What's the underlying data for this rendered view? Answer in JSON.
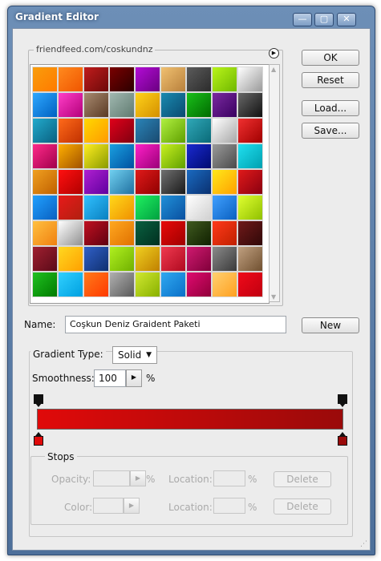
{
  "window": {
    "title": "Gradient Editor",
    "controls": {
      "minimize": "—",
      "maximize": "▢",
      "close": "✕"
    }
  },
  "presets": {
    "label": "friendfeed.com/coskundnz",
    "menu_icon": "triangle-right-icon",
    "swatches": [
      [
        "#f99d0b",
        "#ff7a00"
      ],
      [
        "#ff8a1e",
        "#f05500"
      ],
      [
        "#c01c1c",
        "#6d0a0a"
      ],
      [
        "#7a0000",
        "#2b0000"
      ],
      [
        "#b30cd6",
        "#6a0080"
      ],
      [
        "#f0c070",
        "#b8803c"
      ],
      [
        "#5b5b5b",
        "#2b2b2b"
      ],
      [
        "#b9f41a",
        "#70b800"
      ],
      [
        "#ffffff",
        "#9a9a9a"
      ],
      [
        "#2ea8ff",
        "#0060c0"
      ],
      [
        "#ff3ec8",
        "#b3007a"
      ],
      [
        "#a88a70",
        "#5a3a24"
      ],
      [
        "#a0b8b0",
        "#607a70"
      ],
      [
        "#ffd21a",
        "#d49000"
      ],
      [
        "#1a8ab0",
        "#0a4a70"
      ],
      [
        "#1ac01a",
        "#006a00"
      ],
      [
        "#7a2aa0",
        "#3a0060"
      ],
      [
        "#686868",
        "#111111"
      ],
      [
        "#22aacc",
        "#0a6080"
      ],
      [
        "#ff6a1a",
        "#c03000"
      ],
      [
        "#ffd800",
        "#ff9a00"
      ],
      [
        "#e0001a",
        "#800010"
      ],
      [
        "#2a84b8",
        "#1a4a70"
      ],
      [
        "#b0f040",
        "#60a000"
      ],
      [
        "#30a8b8",
        "#0a6a78"
      ],
      [
        "#ffffff",
        "#a8a8a8"
      ],
      [
        "#f03030",
        "#a00000"
      ],
      [
        "#ff2a8a",
        "#a0004a"
      ],
      [
        "#ffb000",
        "#a05000"
      ],
      [
        "#ffee20",
        "#8a9a00"
      ],
      [
        "#1aa0e0",
        "#0050a0"
      ],
      [
        "#ff20c8",
        "#9a0078"
      ],
      [
        "#c8f020",
        "#60a000"
      ],
      [
        "#1a2ad0",
        "#000a70"
      ],
      [
        "#9a9a9a",
        "#4a4a4a"
      ],
      [
        "#20e0f0",
        "#00a0b0"
      ],
      [
        "#f0a020",
        "#c06000"
      ],
      [
        "#ff1010",
        "#b00000"
      ],
      [
        "#b020d0",
        "#6000a0"
      ],
      [
        "#70d0f0",
        "#2070a0"
      ],
      [
        "#e01a1a",
        "#900000"
      ],
      [
        "#707070",
        "#1a1a1a"
      ],
      [
        "#1a6ac0",
        "#0a3070"
      ],
      [
        "#ffe81a",
        "#ffa000"
      ],
      [
        "#e01a1a",
        "#8a0010"
      ],
      [
        "#20a0ff",
        "#0a60c0"
      ],
      [
        "#e81a1a",
        "#b02010"
      ],
      [
        "#30c0ff",
        "#0a80c0"
      ],
      [
        "#ffd81a",
        "#f09000"
      ],
      [
        "#20f060",
        "#00a040"
      ],
      [
        "#2090d8",
        "#0a50a0"
      ],
      [
        "#ffffff",
        "#d0d0d0"
      ],
      [
        "#40a0ff",
        "#0a60c0"
      ],
      [
        "#e0ff30",
        "#90c000"
      ],
      [
        "#ffc040",
        "#f08010"
      ],
      [
        "#ffffff",
        "#909090"
      ],
      [
        "#c01020",
        "#600010"
      ],
      [
        "#ffa820",
        "#e07000"
      ],
      [
        "#0a6040",
        "#003020"
      ],
      [
        "#e80a0a",
        "#a00000"
      ],
      [
        "#405a20",
        "#102000"
      ],
      [
        "#ff3a1a",
        "#c02000"
      ],
      [
        "#701a1a",
        "#300808"
      ],
      [
        "#a02030",
        "#5a0a18"
      ],
      [
        "#ffd820",
        "#ffa000"
      ],
      [
        "#3060c8",
        "#103070"
      ],
      [
        "#b0f020",
        "#70b000"
      ],
      [
        "#f0d020",
        "#c08000"
      ],
      [
        "#f03a50",
        "#b00a20"
      ],
      [
        "#d01a70",
        "#80003a"
      ],
      [
        "#8a8a8a",
        "#3a3a3a"
      ],
      [
        "#c0a080",
        "#705030"
      ],
      [
        "#20c020",
        "#007a00"
      ],
      [
        "#30d0ff",
        "#00a0e0"
      ],
      [
        "#ff7a1a",
        "#ff3a00"
      ],
      [
        "#b0b0b0",
        "#5a5a5a"
      ],
      [
        "#d0e830",
        "#88b000"
      ],
      [
        "#30a8f0",
        "#0a70c8"
      ],
      [
        "#e00a70",
        "#90003a"
      ],
      [
        "#ffd070",
        "#ffa020"
      ],
      [
        "#f00a1a",
        "#c00010"
      ]
    ]
  },
  "buttons": {
    "ok": "OK",
    "reset": "Reset",
    "load": "Load...",
    "save": "Save...",
    "new": "New",
    "delete_opacity": "Delete",
    "delete_color": "Delete"
  },
  "name_field": {
    "label": "Name:",
    "value": "Coşkun Deniz Graident Paketi"
  },
  "gradient": {
    "type_label": "Gradient Type:",
    "type_value": "Solid",
    "smoothness_label": "Smoothness:",
    "smoothness_value": "100",
    "smoothness_unit": "%",
    "bar_colors": [
      "#e00a0a",
      "#9a0a0a"
    ],
    "stop_left_color": "#e00a0a",
    "stop_right_color": "#9a0a0a"
  },
  "stops": {
    "label": "Stops",
    "opacity_label": "Opacity:",
    "opacity_unit": "%",
    "opacity_location_label": "Location:",
    "opacity_location_unit": "%",
    "color_label": "Color:",
    "color_location_label": "Location:",
    "color_location_unit": "%"
  },
  "colors": {
    "title_bar": "#5d80ac",
    "client_bg": "#ececec"
  }
}
